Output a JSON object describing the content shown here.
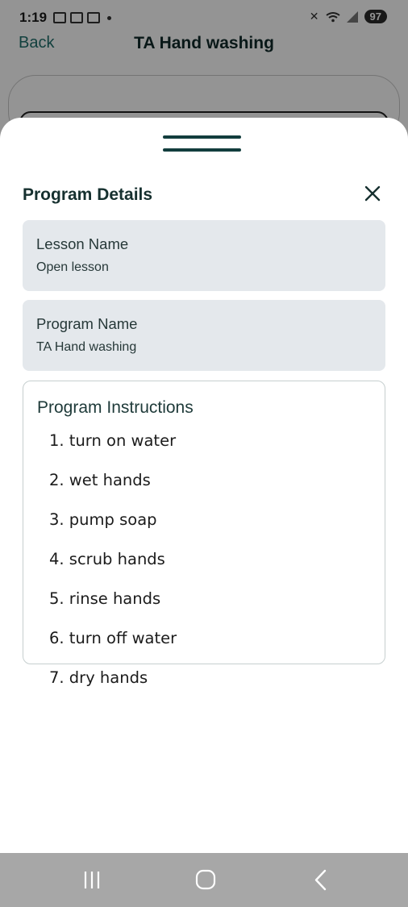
{
  "status_bar": {
    "time": "1:19",
    "battery": "97",
    "icons_left": [
      "calendar-icon",
      "stack-icon",
      "screen-capture-icon",
      "dot-icon"
    ],
    "icons_right": [
      "mute-icon",
      "wifi-icon",
      "signal-icon",
      "battery-icon"
    ]
  },
  "header": {
    "back_label": "Back",
    "title": "TA Hand washing"
  },
  "sheet": {
    "title": "Program Details",
    "close_icon": "close-icon",
    "lesson": {
      "label": "Lesson Name",
      "value": "Open lesson"
    },
    "program": {
      "label": "Program Name",
      "value": "TA Hand washing"
    },
    "instructions": {
      "title": "Program Instructions",
      "items": [
        "1. turn on water",
        "2. wet hands",
        "3. pump soap",
        "4. scrub hands",
        "5. rinse hands",
        "6. turn off water",
        "7. dry hands"
      ]
    }
  },
  "nav": {
    "recent_icon": "recent-apps-icon",
    "home_icon": "home-icon",
    "back_icon": "back-icon"
  },
  "colors": {
    "accent": "#1f6f6c",
    "handle": "#123d3d",
    "card_bg": "#e4e8ec",
    "nav_bg": "#a7a7a7"
  }
}
